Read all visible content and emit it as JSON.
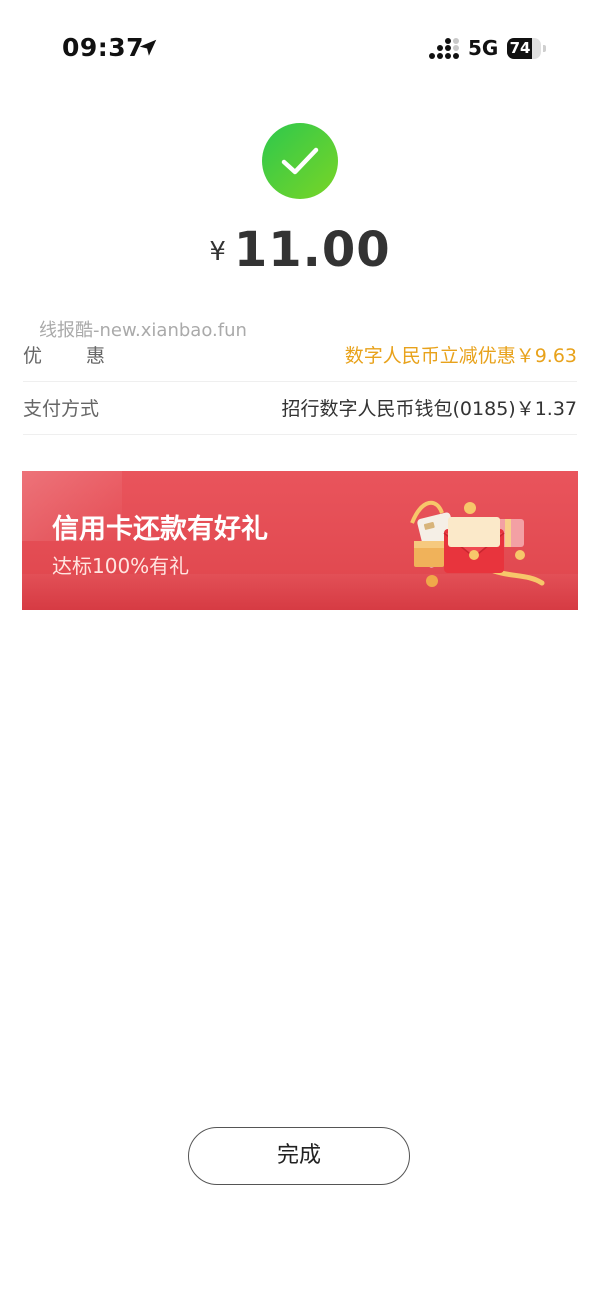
{
  "status_bar": {
    "time": "09:37",
    "network": "5G",
    "battery_level": 74,
    "battery_label": "74",
    "icons": [
      "location-arrow-icon",
      "signal-icon",
      "battery-icon"
    ]
  },
  "result": {
    "status_icon": "success-check-icon",
    "status_color": "#52c41a",
    "currency_symbol": "¥",
    "amount": "11.00"
  },
  "watermark": "线报酷-new.xianbao.fun",
  "details": [
    {
      "label": "优惠",
      "value": "数字人民币立减优惠￥9.63",
      "value_color": "#e8a21b"
    },
    {
      "label": "支付方式",
      "value": "招行数字人民币钱包(0185)￥1.37"
    }
  ],
  "banner": {
    "title": "信用卡还款有好礼",
    "subtitle": "达标100%有礼",
    "background_color": "#e24a51",
    "illustration": "gift-box-icon"
  },
  "done_button": {
    "label": "完成"
  }
}
